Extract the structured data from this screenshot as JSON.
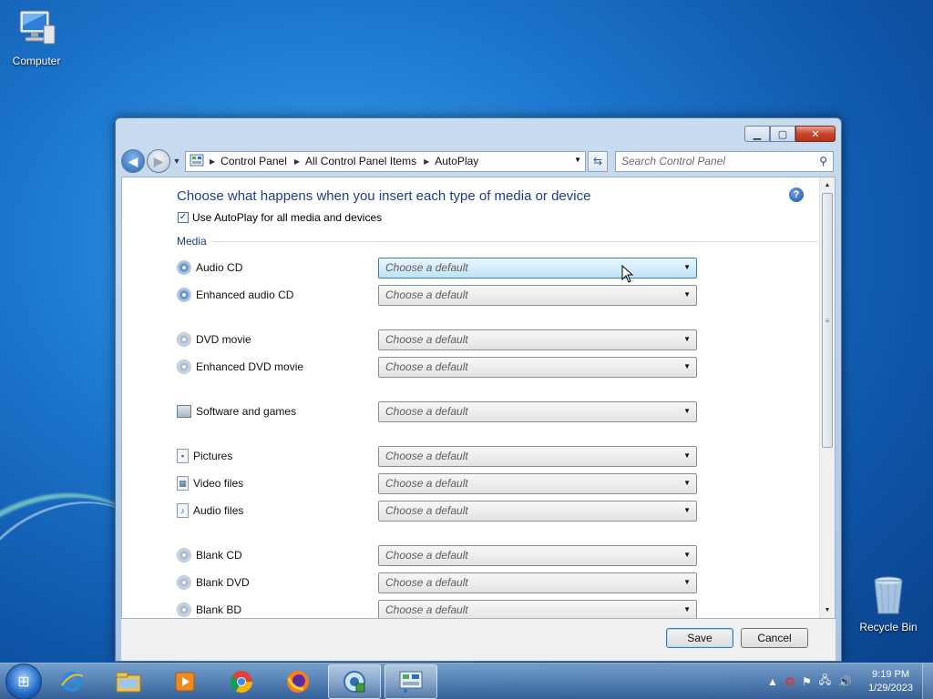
{
  "desktop": {
    "icons": [
      {
        "label": "Computer"
      },
      {
        "label": "Recycle Bin"
      }
    ]
  },
  "window": {
    "nav": {
      "breadcrumb": [
        "Control Panel",
        "All Control Panel Items",
        "AutoPlay"
      ],
      "search_placeholder": "Search Control Panel"
    },
    "heading": "Choose what happens when you insert each type of media or device",
    "use_autoplay_label": "Use AutoPlay for all media and devices",
    "use_autoplay_checked": true,
    "section_media": "Media",
    "media_rows": [
      {
        "label": "Audio CD",
        "value": "Choose a default",
        "icon": "audio-cd-icon"
      },
      {
        "label": "Enhanced audio CD",
        "value": "Choose a default",
        "icon": "audio-cd-icon"
      },
      {
        "label": "DVD movie",
        "value": "Choose a default",
        "icon": "dvd-icon"
      },
      {
        "label": "Enhanced DVD movie",
        "value": "Choose a default",
        "icon": "dvd-icon"
      },
      {
        "label": "Software and games",
        "value": "Choose a default",
        "icon": "software-icon"
      },
      {
        "label": "Pictures",
        "value": "Choose a default",
        "icon": "picture-file-icon"
      },
      {
        "label": "Video files",
        "value": "Choose a default",
        "icon": "video-file-icon"
      },
      {
        "label": "Audio files",
        "value": "Choose a default",
        "icon": "audio-file-icon"
      },
      {
        "label": "Blank CD",
        "value": "Choose a default",
        "icon": "blank-disc-icon"
      },
      {
        "label": "Blank DVD",
        "value": "Choose a default",
        "icon": "blank-disc-icon"
      },
      {
        "label": "Blank BD",
        "value": "Choose a default",
        "icon": "blank-disc-icon"
      }
    ],
    "buttons": {
      "save": "Save",
      "cancel": "Cancel"
    }
  },
  "taskbar": {
    "time": "9:19 PM",
    "date": "1/29/2023",
    "apps": [
      "internet-explorer-icon",
      "file-explorer-icon",
      "media-player-icon",
      "chrome-icon",
      "firefox-icon",
      "network-app-icon",
      "control-panel-icon"
    ]
  }
}
